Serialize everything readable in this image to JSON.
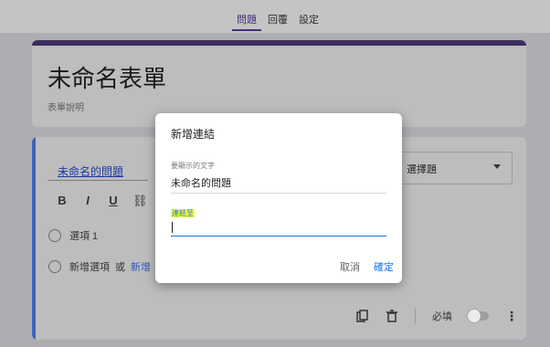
{
  "tabs": [
    "問題",
    "回覆",
    "設定"
  ],
  "form": {
    "title": "未命名表單",
    "description": "表單說明"
  },
  "question": {
    "title": "未命名的問題",
    "type": "選擇題",
    "option1": "選項 1",
    "add_option": "新增選項",
    "or": "或",
    "add_other": "新增「其",
    "required_label": "必填",
    "toolbar": {
      "bold": "B",
      "italic": "I",
      "underline": "U",
      "link": "⛓"
    }
  },
  "dialog": {
    "title": "新增連結",
    "text_label": "要顯示的文字",
    "text_value": "未命名的問題",
    "link_label": "連結至",
    "cancel": "取消",
    "ok": "確定"
  }
}
